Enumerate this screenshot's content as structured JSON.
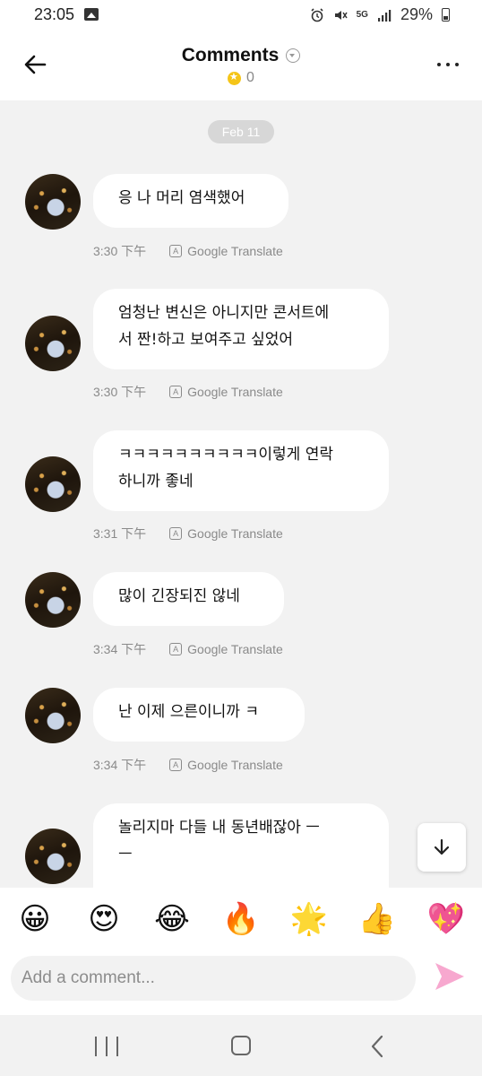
{
  "status_bar": {
    "time": "23:05",
    "network": "5G",
    "battery": "29%",
    "icons": [
      "gallery-icon",
      "alarm-icon",
      "mute-icon",
      "signal-icon",
      "battery-icon"
    ]
  },
  "header": {
    "title": "Comments",
    "coin_count": "0"
  },
  "date_divider": "Feb 11",
  "messages": [
    {
      "text": "응 나 머리 염색했어",
      "time": "3:30 下午",
      "translate": "Google Translate"
    },
    {
      "text": "엄청난 변신은 아니지만 콘서트에\n서 짠!하고 보여주고 싶었어",
      "time": "3:30 下午",
      "translate": "Google Translate"
    },
    {
      "text": "ㅋㅋㅋㅋㅋㅋㅋㅋㅋㅋ이렇게 연락\n하니까 좋네",
      "time": "3:31 下午",
      "translate": "Google Translate"
    },
    {
      "text": "많이 긴장되진 않네",
      "time": "3:34 下午",
      "translate": "Google Translate"
    },
    {
      "text": "난 이제 으른이니까 ㅋ",
      "time": "3:34 下午",
      "translate": "Google Translate"
    },
    {
      "text": "놀리지마 다들 내 동년배잖아 ㅡ\nㅡ"
    }
  ],
  "emoji_bar": [
    "😀",
    "😍",
    "😂",
    "🔥",
    "🌟",
    "👍",
    "💖"
  ],
  "comment_input": {
    "placeholder": "Add a comment..."
  },
  "colors": {
    "background": "#f2f2f2",
    "bubble": "#ffffff",
    "send_accent": "#f7a8cf",
    "coin": "#f5c518"
  }
}
